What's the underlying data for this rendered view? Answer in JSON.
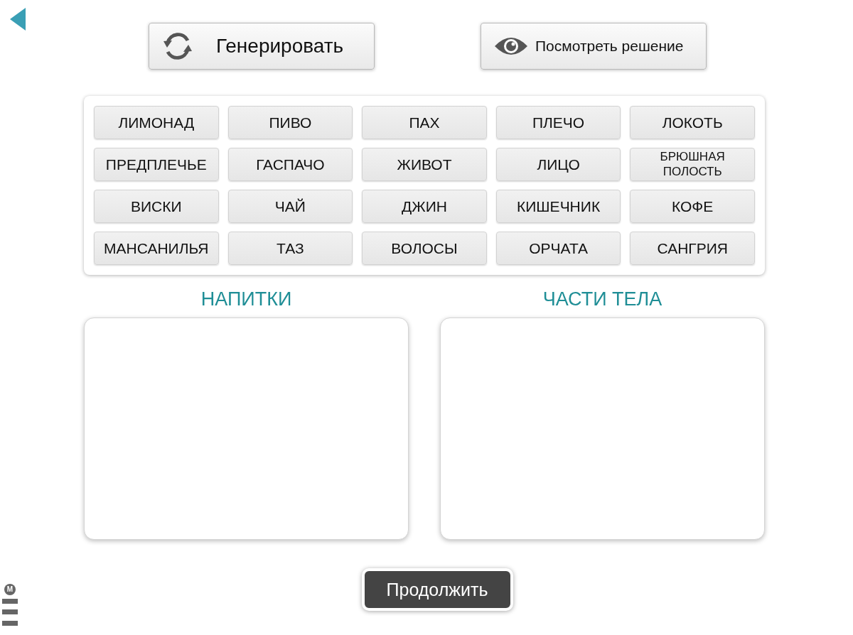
{
  "toolbar": {
    "generate_button": "Генерировать",
    "solution_button": "Посмотреть решение"
  },
  "word_bank": [
    "ЛИМОНАД",
    "ПИВО",
    "ПАХ",
    "ПЛЕЧО",
    "ЛОКОТЬ",
    "ПРЕДПЛЕЧЬЕ",
    "ГАСПАЧО",
    "ЖИВОТ",
    "ЛИЦО",
    "БРЮШНАЯ ПОЛОСТЬ",
    "ВИСКИ",
    "ЧАЙ",
    "ДЖИН",
    "КИШЕЧНИК",
    "КОФЕ",
    "МАНСАНИЛЬЯ",
    "ТАЗ",
    "ВОЛОСЫ",
    "ОРЧАТА",
    "САНГРИЯ"
  ],
  "categories": [
    {
      "title": "НАПИТКИ"
    },
    {
      "title": "ЧАСТИ ТЕЛА"
    }
  ],
  "continue_button": "Продолжить",
  "corner_menu": {
    "badge": "M"
  }
}
